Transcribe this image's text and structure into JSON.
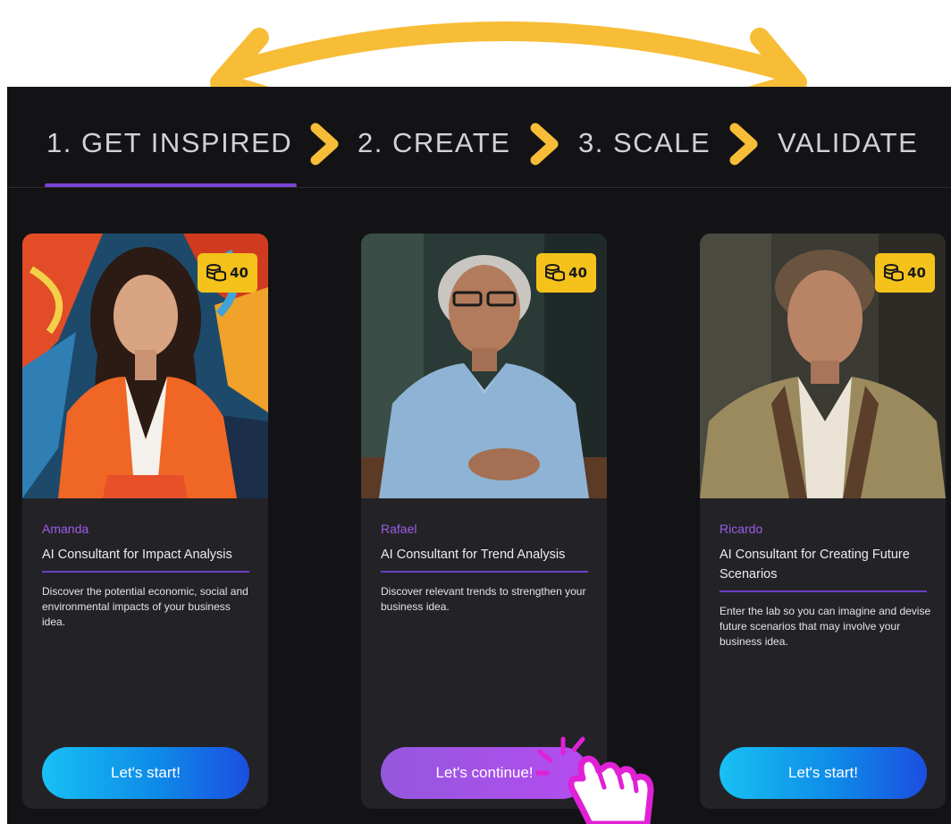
{
  "colors": {
    "accent_yellow": "#f7bd37",
    "accent_purple": "#7b45d8",
    "background": "#131316",
    "card_background": "#232327",
    "badge_yellow": "#f4c21b",
    "button_blue": "#0e8be8",
    "button_purple": "#a451e8",
    "pointer_magenta": "#e021d6"
  },
  "steps": [
    {
      "label": "1. GET INSPIRED",
      "active": true
    },
    {
      "label": "2. CREATE",
      "active": false
    },
    {
      "label": "3. SCALE",
      "active": false
    },
    {
      "label": "VALIDATE",
      "active": false
    }
  ],
  "cards": [
    {
      "credits": "40",
      "credits_icon": "coins-icon",
      "name": "Amanda",
      "role": "AI Consultant for Impact Analysis",
      "description": "Discover the potential economic, social and environmental impacts of your business idea.",
      "button_label": "Let's start!"
    },
    {
      "credits": "40",
      "credits_icon": "coins-icon",
      "name": "Rafael",
      "role": "AI Consultant for Trend Analysis",
      "description": "Discover relevant trends to strengthen your business idea.",
      "button_label": "Let's continue!"
    },
    {
      "credits": "40",
      "credits_icon": "coins-icon",
      "name": "Ricardo",
      "role": "AI Consultant for Creating Future Scenarios",
      "description": "Enter the lab so you can imagine and devise future scenarios that may involve your business idea.",
      "button_label": "Let's start!"
    }
  ],
  "icons": {
    "steps_separator": "chevron-right-icon",
    "loop_arrow": "double-headed-arrow-icon",
    "cursor": "hand-pointer-icon"
  }
}
